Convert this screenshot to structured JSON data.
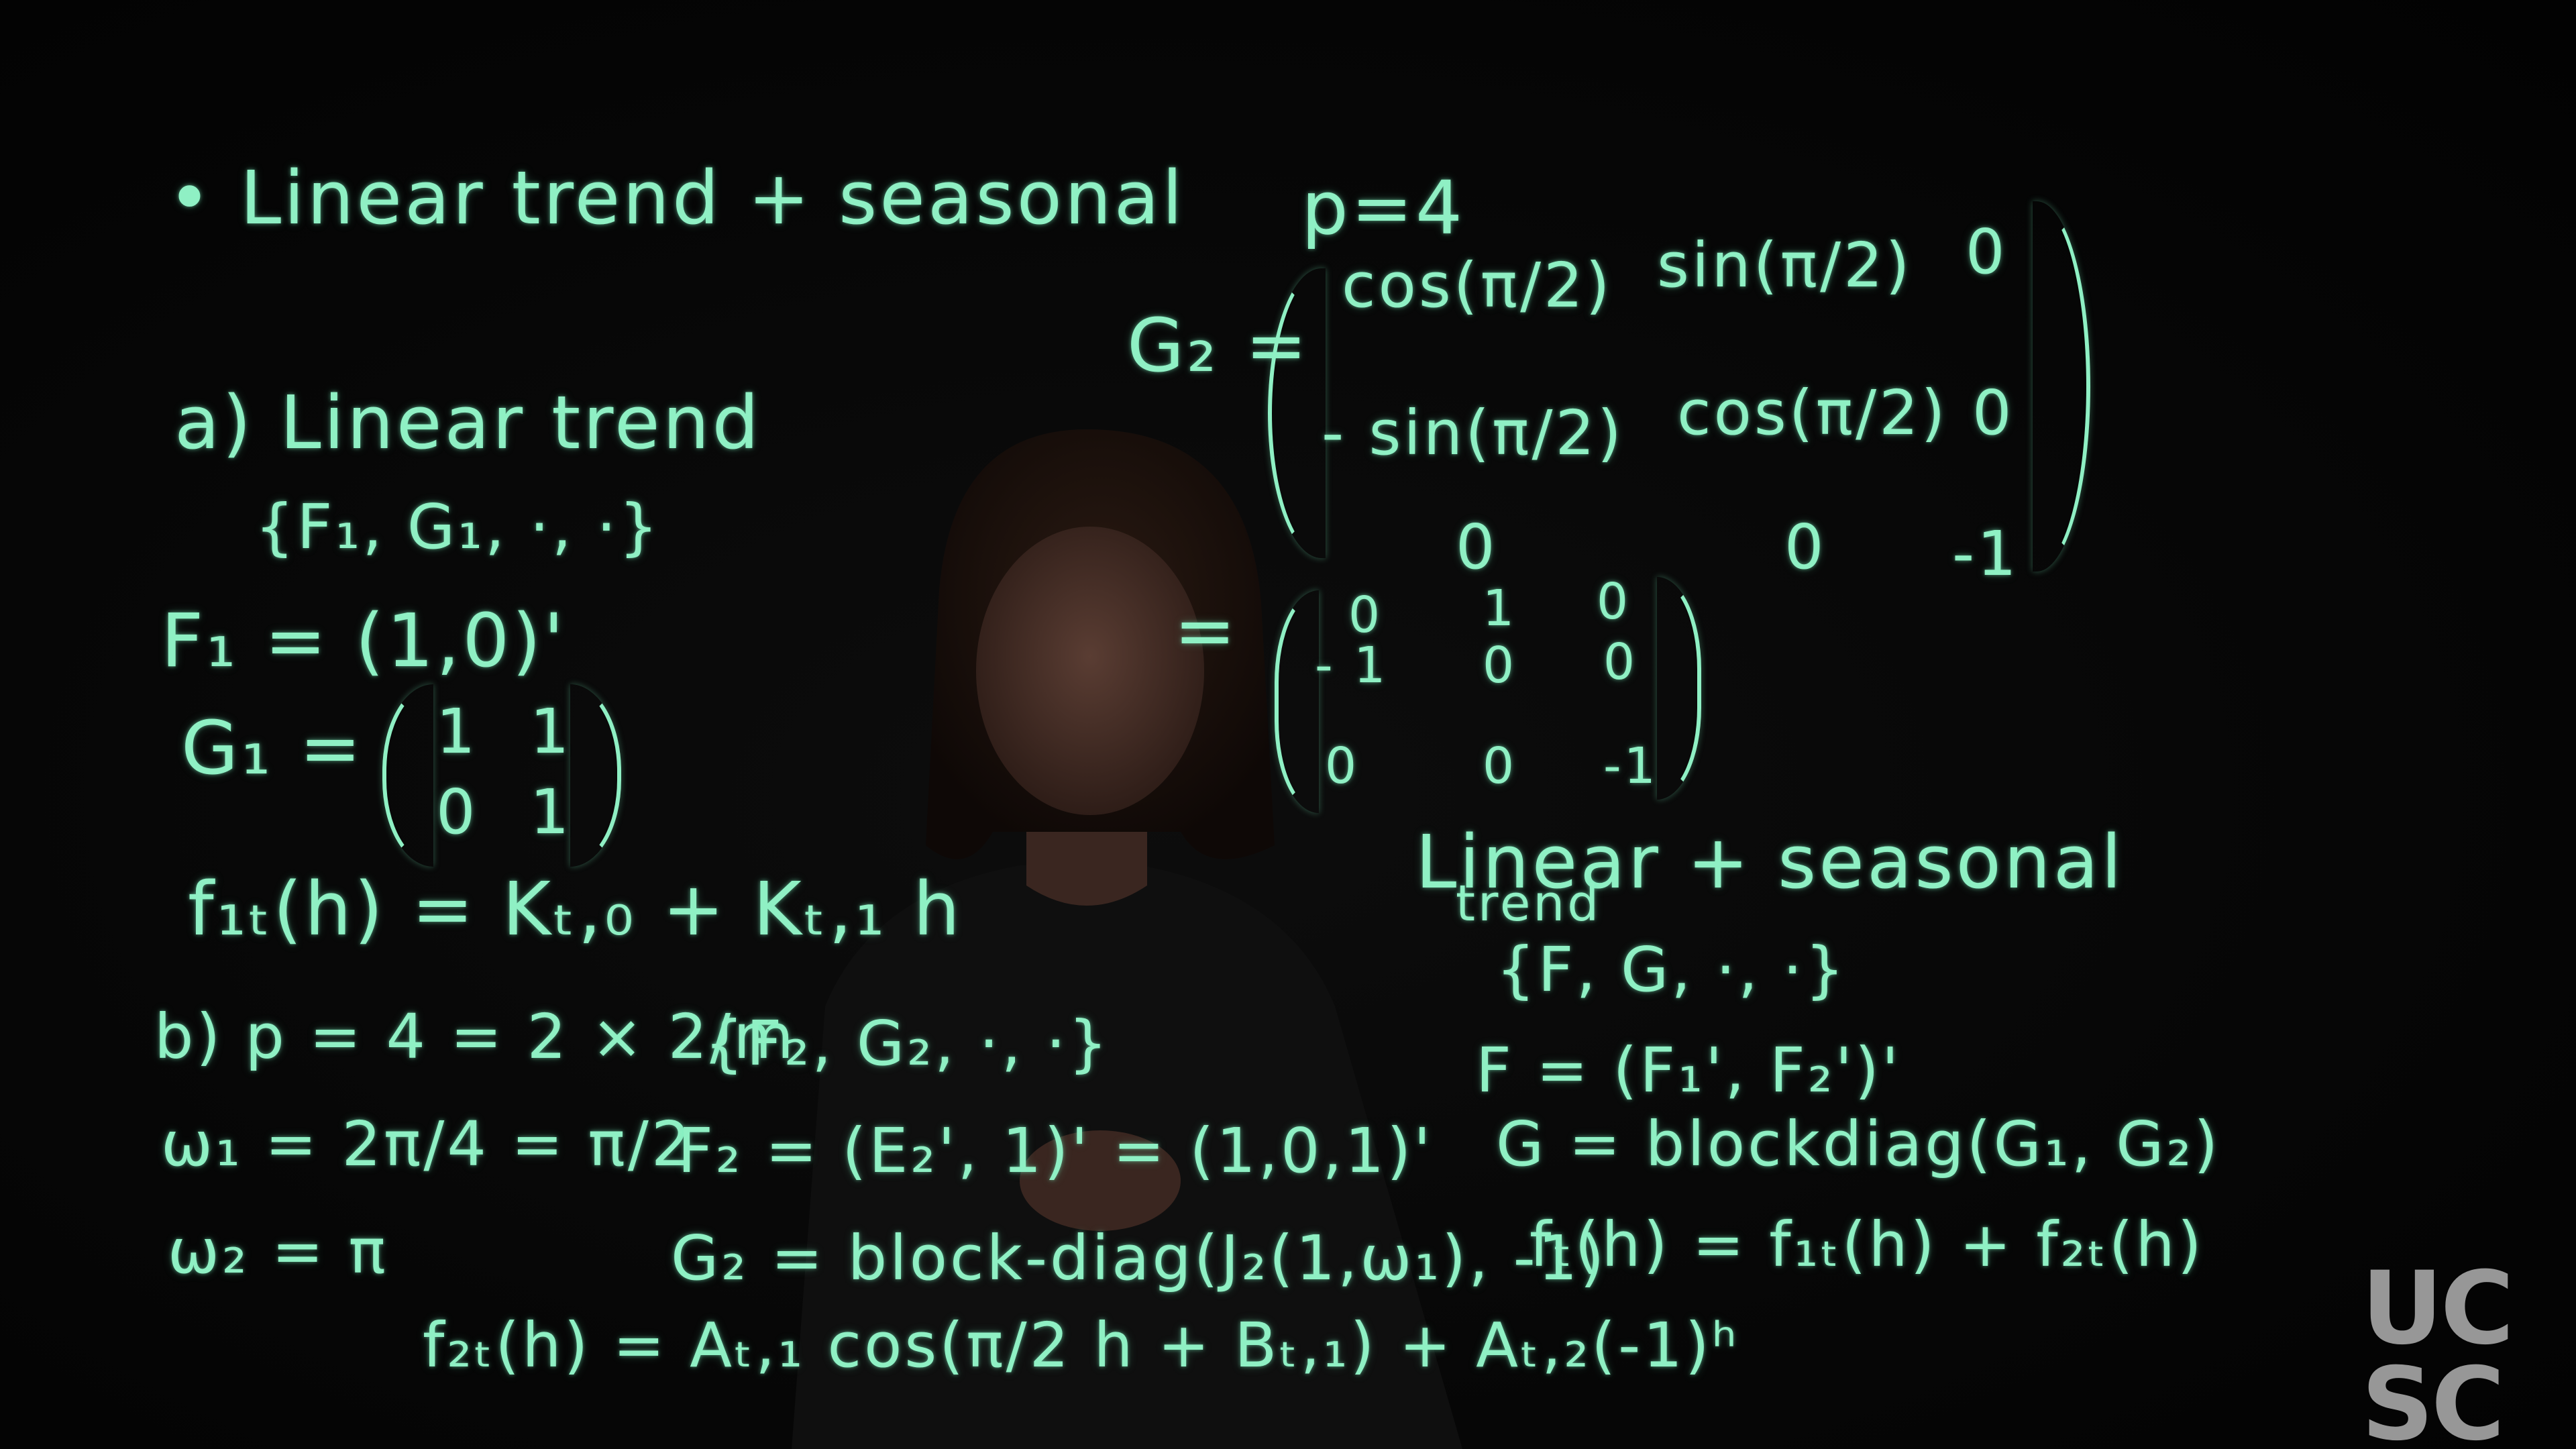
{
  "board": {
    "title_left": "• Linear trend + seasonal",
    "title_right": "p=4",
    "a_label": "a) Linear trend",
    "a_set": "{F₁, G₁, ·, ·}",
    "F1": "F₁ = (1,0)'",
    "G1_lhs": "G₁ =",
    "G1_matrix": [
      [
        "1",
        "1"
      ],
      [
        "0",
        "1"
      ]
    ],
    "f1t": "f₁ₜ(h) = Kₜ,₀ + Kₜ,₁ h",
    "b_label": "b) p = 4 = 2 × 2/m",
    "b_set": "{F₂, G₂, ·, ·}",
    "w1": "ω₁ = 2π/4 = π/2",
    "w2": "ω₂ = π",
    "F2": "F₂ = (E₂', 1)' = (1,0,1)'",
    "G2_block": "G₂ = block-diag(J₂(1,ω₁), -1)",
    "f2t": "f₂ₜ(h) = Aₜ,₁ cos(π/2 h + Bₜ,₁) + Aₜ,₂(-1)ʰ",
    "G2_lhs": "G₂ =",
    "G2_matrix": [
      [
        "cos(π/2)",
        "sin(π/2)",
        "0"
      ],
      [
        "- sin(π/2)",
        "cos(π/2)",
        "0"
      ],
      [
        "0",
        "0",
        "-1"
      ]
    ],
    "eq_sign": "=",
    "G2_numeric": [
      [
        "0",
        "1",
        "0"
      ],
      [
        "- 1",
        "0",
        "0"
      ],
      [
        "0",
        "0",
        "-1"
      ]
    ],
    "right_title_1": "Linear + seasonal",
    "right_title_2": "trend",
    "right_set": "{F, G, ·, ·}",
    "F_full": "F = (F₁', F₂')'",
    "G_full": "G = blockdiag(G₁, G₂)",
    "ft": "fₜ(h) = f₁ₜ(h) + f₂ₜ(h)"
  },
  "logo": {
    "line1": "UC",
    "line2": "SC"
  },
  "colors": {
    "ink": "#8ff0c4",
    "background": "#050505",
    "logo": "#bcbcbc"
  }
}
